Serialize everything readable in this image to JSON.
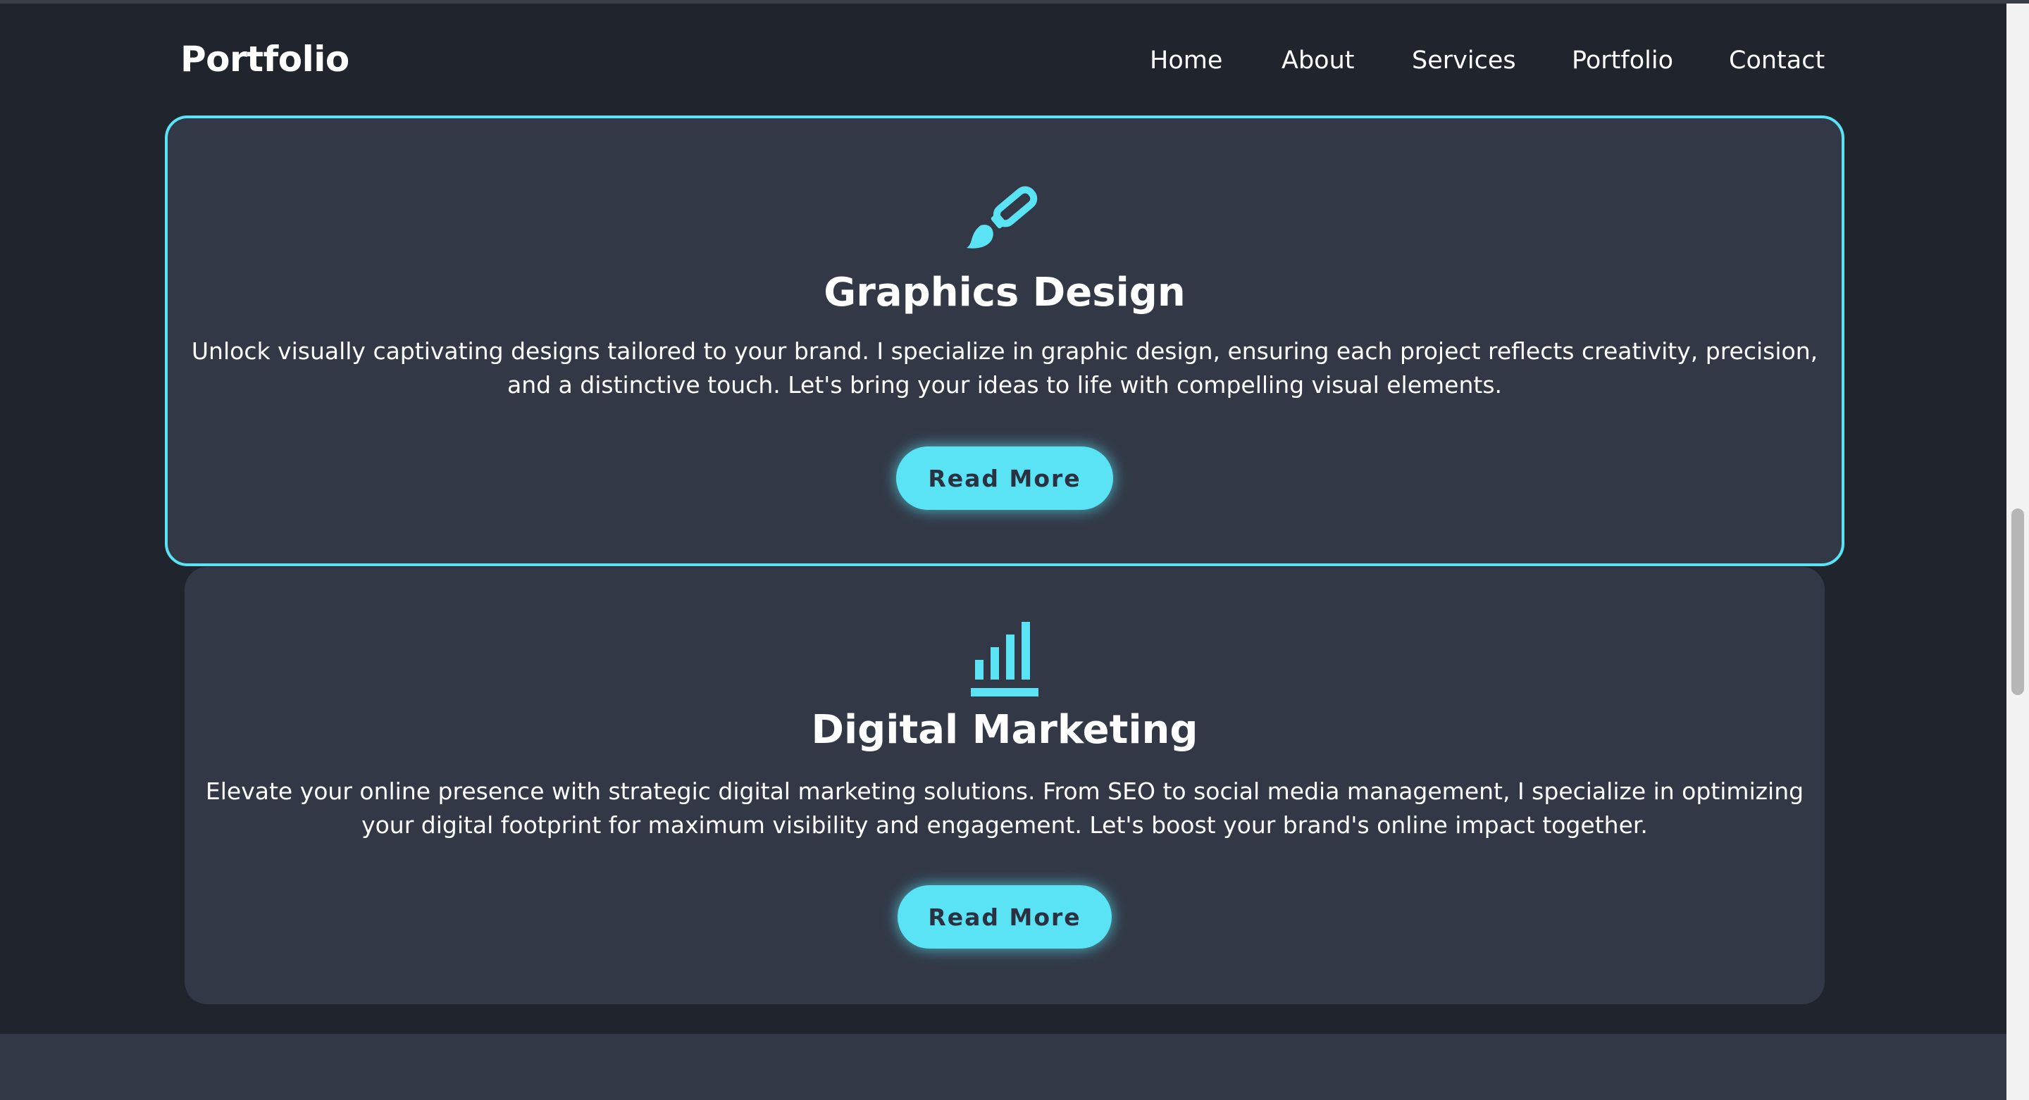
{
  "header": {
    "logo": "Portfolio",
    "nav": [
      "Home",
      "About",
      "Services",
      "Portfolio",
      "Contact"
    ]
  },
  "services": [
    {
      "icon": "paintbrush-icon",
      "title": "Graphics Design",
      "desc_line1": "Unlock visually captivating designs tailored to your brand. I specialize in graphic design, ensuring each project reflects creativity, precision,",
      "desc_line2": "and a distinctive touch. Let's bring your ideas to life with compelling visual elements.",
      "button": "Read More",
      "highlighted": true
    },
    {
      "icon": "bar-chart-icon",
      "title": "Digital Marketing",
      "desc_line1": "Elevate your online presence with strategic digital marketing solutions. From SEO to social media management, I specialize in optimizing",
      "desc_line2": "your digital footprint for maximum visibility and engagement. Let's boost your brand's online impact together.",
      "button": "Read More",
      "highlighted": false
    }
  ],
  "colors": {
    "background": "#1f242d",
    "card": "#323846",
    "accent": "#5ae3f5",
    "text": "#ffffff",
    "button_text": "#2b3140"
  }
}
